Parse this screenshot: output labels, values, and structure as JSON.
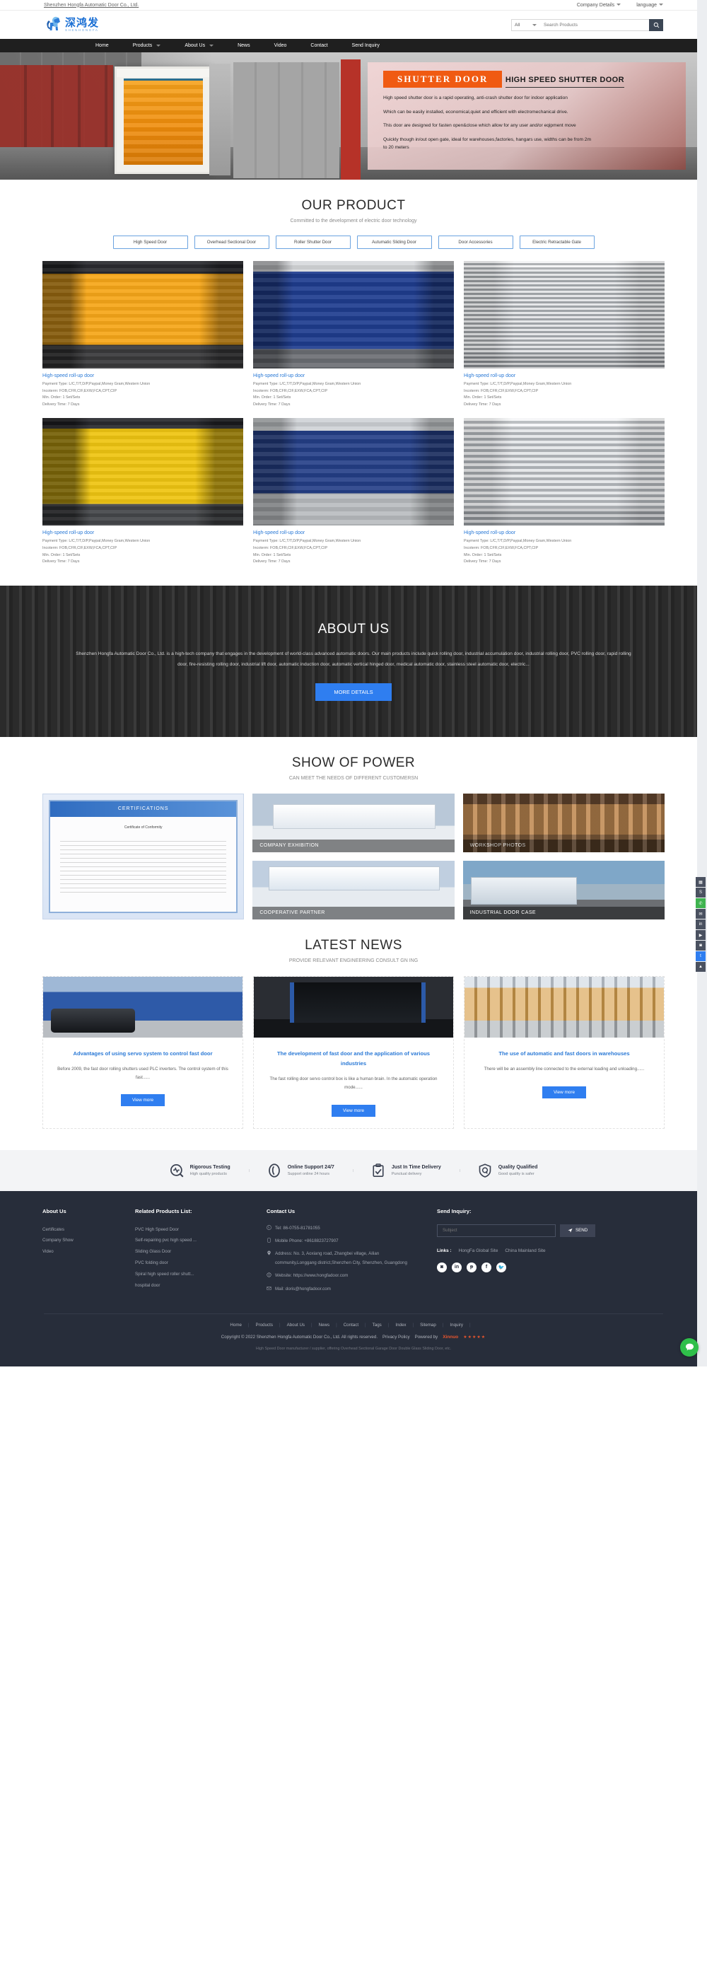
{
  "topbar": {
    "company_link": "Shenzhen Hongfa Automatic Door Co., Ltd.",
    "company_details": "Company Details",
    "language": "language"
  },
  "header": {
    "logo_cn": "深鸿发",
    "logo_en": "SHENHONGFA",
    "search_category": "All",
    "search_placeholder": "Search Products"
  },
  "nav": {
    "items": [
      {
        "label": "Home",
        "has_caret": false
      },
      {
        "label": "Products",
        "has_caret": true
      },
      {
        "label": "About Us",
        "has_caret": true
      },
      {
        "label": "News",
        "has_caret": false
      },
      {
        "label": "Video",
        "has_caret": false
      },
      {
        "label": "Contact",
        "has_caret": false
      },
      {
        "label": "Send Inquiry",
        "has_caret": false
      }
    ]
  },
  "banner": {
    "tag": "SHUTTER DOOR",
    "heading": "HIGH SPEED SHUTTER DOOR",
    "paragraphs": [
      "High speed shutter door is a rapid operating, anti-crash shutter door for indoor application",
      "Which can be easily installed, economical,quiet and efficient with electromechanical drive.",
      "This door are designed for fasten open&close which allow for any user and/or eqipment move",
      "Quickly though in/out open gate, ideal for warehouses,factories, hangars use, widths can be from 2m to 20 meters"
    ]
  },
  "products": {
    "title": "OUR PRODUCT",
    "subtitle": "Committed to the development of electric door technology",
    "tabs": [
      "High Speed Door",
      "Overhead Sectional Door",
      "Roller Shutter Door",
      "Autumatic Sliding Door",
      "Door Accessories",
      "Electric Retractable Gate"
    ],
    "items": [
      {
        "name": "High-speed roll-up door",
        "payment": "Payment Type: L/C,T/T,D/P,Paypal,Money Gram,Western Union",
        "incoterm": "Incoterm: FOB,CFR,CIF,EXW,FCA,CPT,CIP",
        "min_order": "Min. Order: 1 Set/Sets",
        "delivery": "Delivery Time: 7 Days",
        "art": "img-orange"
      },
      {
        "name": "High-speed roll-up door",
        "payment": "Payment Type: L/C,T/T,D/P,Paypal,Money Gram,Western Union",
        "incoterm": "Incoterm: FOB,CFR,CIF,EXW,FCA,CPT,CIP",
        "min_order": "Min. Order: 1 Set/Sets",
        "delivery": "Delivery Time: 7 Days",
        "art": "img-blue"
      },
      {
        "name": "High-speed roll-up door",
        "payment": "Payment Type: L/C,T/T,D/P,Paypal,Money Gram,Western Union",
        "incoterm": "Incoterm: FOB,CFR,CIF,EXW,FCA,CPT,CIP",
        "min_order": "Min. Order: 1 Set/Sets",
        "delivery": "Delivery Time: 7 Days",
        "art": "img-steel"
      },
      {
        "name": "High-speed roll-up door",
        "payment": "Payment Type: L/C,T/T,D/P,Paypal,Money Gram,Western Union",
        "incoterm": "Incoterm: FOB,CFR,CIF,EXW,FCA,CPT,CIP",
        "min_order": "Min. Order: 1 Set/Sets",
        "delivery": "Delivery Time: 7 Days",
        "art": "img-yellow"
      },
      {
        "name": "High-speed roll-up door",
        "payment": "Payment Type: L/C,T/T,D/P,Paypal,Money Gram,Western Union",
        "incoterm": "Incoterm: FOB,CFR,CIF,EXW,FCA,CPT,CIP",
        "min_order": "Min. Order: 1 Set/Sets",
        "delivery": "Delivery Time: 7 Days",
        "art": "img-blue2"
      },
      {
        "name": "High-speed roll-up door",
        "payment": "Payment Type: L/C,T/T,D/P,Paypal,Money Gram,Western Union",
        "incoterm": "Incoterm: FOB,CFR,CIF,EXW,FCA,CPT,CIP",
        "min_order": "Min. Order: 1 Set/Sets",
        "delivery": "Delivery Time: 7 Days",
        "art": "img-steel2"
      }
    ]
  },
  "about": {
    "title": "ABOUT US",
    "text": "Shenzhen Hongfa Automatic Door Co., Ltd. is a high-tech company that engages in the development of world-class advanced automatic doors. Our main products include quick rolling door, industrial accumulation door, industrial rolling door, PVC rolling door, rapid rolling door, fire-resisting rolling door, industrial lift door, automatic induction door, automatic vertical hinged door, medical automatic door, stainless steel automatic door, electric...",
    "button": "MORE DETAILS"
  },
  "power": {
    "title": "SHOW OF POWER",
    "subtitle": "CAN MEET THE NEEDS OF DIFFERENT CUSTOMERSN",
    "certificate": {
      "band": "CERTIFICATIONS",
      "caption": "Certificate of Conformity"
    },
    "cards": [
      {
        "label": "COMPANY EXHIBITION",
        "art": "pw-exhibit"
      },
      {
        "label": "WORKSHOP PHOTOS",
        "art": "pw-workshop"
      },
      {
        "label": "COOPERATIVE PARTNER",
        "art": "pw-partner"
      },
      {
        "label": "INDUSTRIAL DOOR CASE",
        "art": "pw-industrial"
      }
    ]
  },
  "news": {
    "title": "LATEST NEWS",
    "subtitle": "PROVIDE RELEVANT ENGINEERING CONSULT GN ING",
    "items": [
      {
        "title": "Advantages of using servo system to control fast door",
        "desc": "Before 2009, the fast door rolling shutters used PLC inverters. The control system of this fast......",
        "button": "View more",
        "art": "ni-1"
      },
      {
        "title": "The development of fast door and the application of various industries",
        "desc": "The fast rolling door servo control box is like a human brain. In the automatic operation mode......",
        "button": "View more",
        "art": "ni-2"
      },
      {
        "title": "The use of automatic and fast doors in warehouses",
        "desc": "There will be an assembly line connected to the external loading and unloading......",
        "button": "View more",
        "art": "ni-3"
      }
    ]
  },
  "features": [
    {
      "icon": "magnifier-pulse-icon",
      "title": "Rigorous Testing",
      "sub": "High quality products"
    },
    {
      "icon": "headset-icon",
      "title": "Online Support 24/7",
      "sub": "Support online 24 hours"
    },
    {
      "icon": "clipboard-check-icon",
      "title": "Just In Time Delivery",
      "sub": "Punctual delivery"
    },
    {
      "icon": "shield-q-icon",
      "title": "Quality Qualified",
      "sub": "Good quality is safer"
    }
  ],
  "footer": {
    "about": {
      "heading": "About Us",
      "items": [
        "Certificates",
        "Company Show",
        "Video"
      ]
    },
    "related": {
      "heading": "Related Products List:",
      "items": [
        "PVC High Speed Door",
        "Self-repairing pvc high speed ...",
        "Sliding Glass Door",
        "PVC folding door",
        "Spiral high speed roller shutt...",
        "hospital door"
      ]
    },
    "contact": {
      "heading": "Contact Us",
      "tel": "Tel: 86-0755-81781055",
      "mobile": "Mobile Phone: +8618823727907",
      "address": "Address: No. 3, Aoxiang road, Zhangbei village, Ailian community,Longgang district,Shenzhen City, Shenzhen, Guangdong",
      "website": "Website: https://www.hongfadoor.com",
      "mail": "Mail: doris@hongfadoor.com"
    },
    "inquiry": {
      "heading": "Send Inquiry:",
      "placeholder": "Subject",
      "send_label": "SEND",
      "links_label": "Links :",
      "links": [
        "HongFa Global Site",
        "China Mainland Site"
      ],
      "socials": [
        "instagram-icon",
        "linkedin-icon",
        "pinterest-icon",
        "facebook-icon",
        "twitter-icon"
      ]
    },
    "bottom_nav": [
      "Home",
      "Products",
      "About Us",
      "News",
      "Contact",
      "Tags",
      "Index",
      "Sitemap",
      "Inquiry"
    ],
    "copyright": "Copyright © 2022 Shenzhen Hongfa Automatic Door Co., Ltd. All rights reserved.",
    "privacy": "Privacy Policy",
    "powered_by": "Powered by",
    "powered_logo": "Xinnuo",
    "stars": "★★★★★",
    "seo_text": "High Speed Door manufacturer / supplier, offering Overhead Sectional Garage Door Double Glass Sliding Door, etc."
  },
  "rail": [
    {
      "icon": "qr-icon"
    },
    {
      "icon": "skype-icon"
    },
    {
      "icon": "whatsapp-icon"
    },
    {
      "icon": "mail-icon"
    },
    {
      "icon": "linkedin-icon"
    },
    {
      "icon": "youtube-icon"
    },
    {
      "icon": "instagram-icon"
    },
    {
      "icon": "twitter-icon"
    },
    {
      "icon": "arrow-up-icon"
    }
  ],
  "colors": {
    "accent_blue": "#2f7ef0",
    "link_blue": "#2a79d6",
    "orange": "#f05a12",
    "nav_dark": "#1f1f1f",
    "footer_dark": "#272d3a",
    "chat_green": "#2fbf4a"
  }
}
